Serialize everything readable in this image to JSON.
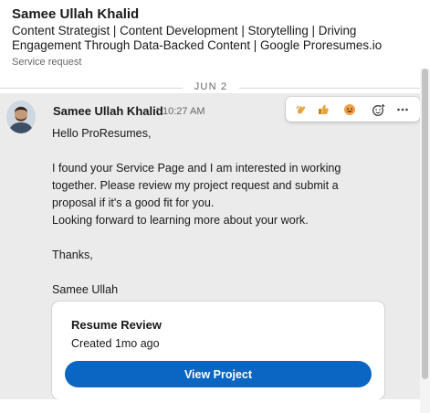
{
  "conversation": {
    "name": "Samee Ullah Khalid",
    "headline": "Content Strategist | Content Development | Storytelling | Driving Engagement Through Data-Backed Content | Google Proresumes.io",
    "subtitle": "Service request"
  },
  "thread": {
    "date_divider": "JUN 2"
  },
  "message": {
    "sender": "Samee Ullah Khalid",
    "separator": "•",
    "time": "10:27 AM",
    "lines": [
      "Hello ProResumes,",
      "I found your Service Page and I am interested in working",
      "together. Please review my project request and submit a",
      "proposal if it's a good fit for you.",
      "Looking forward to learning more about your work.",
      "Thanks,",
      "Samee Ullah"
    ],
    "reactions": [
      "clapping-hands-icon",
      "thumbs-up-icon",
      "smiling-face-icon",
      "add-reaction-icon",
      "more-options-icon"
    ]
  },
  "card": {
    "title": "Resume Review",
    "meta": "Created 1mo ago",
    "button_label": "View Project"
  },
  "colors": {
    "accent": "#0a66c2",
    "message_background": "#ebebeb",
    "text": "#191919",
    "muted": "#666666"
  }
}
